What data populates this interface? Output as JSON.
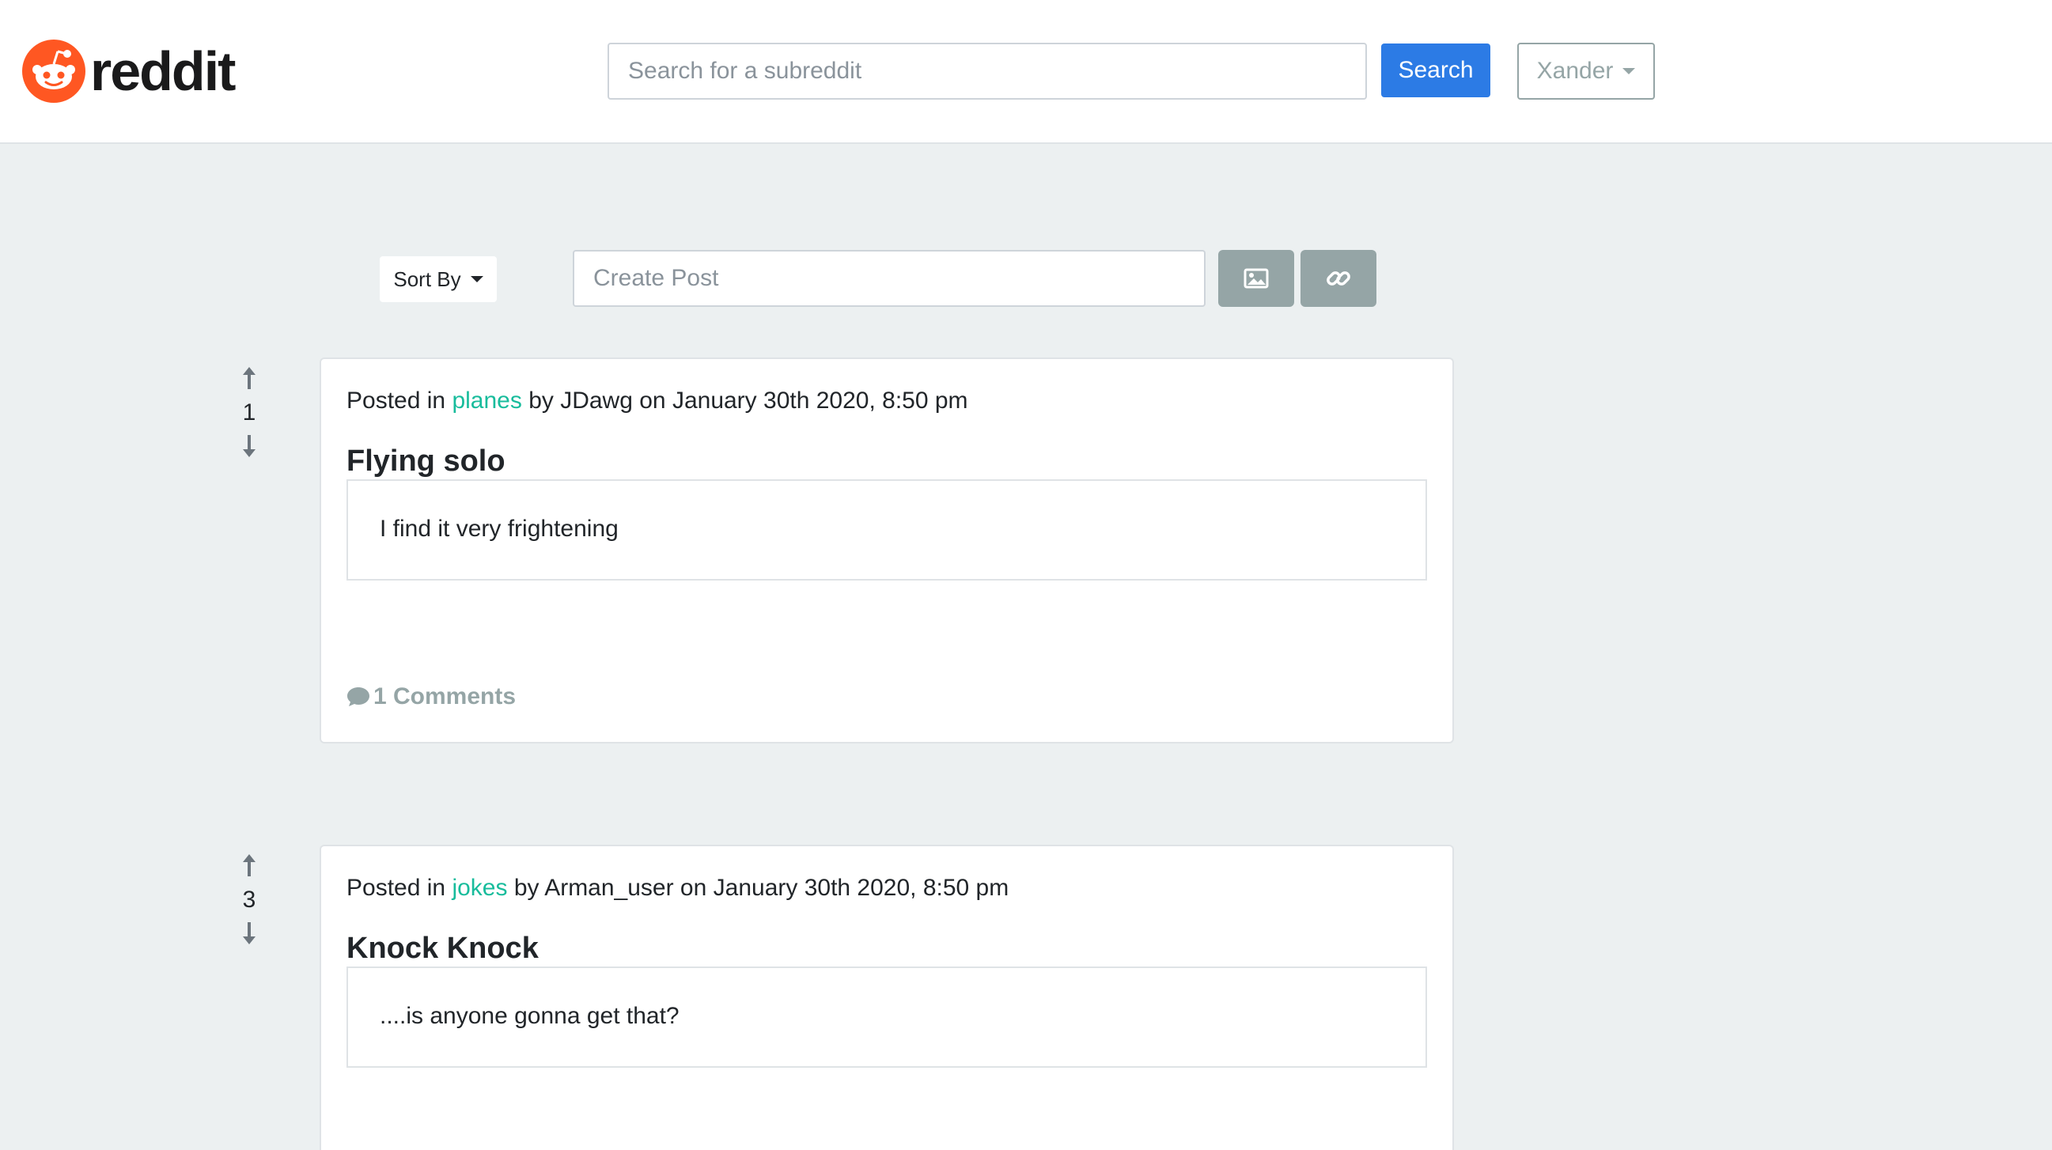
{
  "navbar": {
    "brand": "reddit",
    "search_placeholder": "Search for a subreddit",
    "search_button": "Search",
    "user_menu": "Xander",
    "logo_color": "#ff5722"
  },
  "toolbar": {
    "sort_label": "Sort By",
    "create_post_placeholder": "Create Post",
    "image_button_icon": "image-icon",
    "link_button_icon": "link-icon"
  },
  "posts": [
    {
      "votes": "1",
      "meta_prefix": "Posted in",
      "subreddit": "planes",
      "meta_suffix": "by JDawg on January 30th 2020, 8:50 pm",
      "title": "Flying solo",
      "body": "I find it very frightening",
      "comments": "1 Comments"
    },
    {
      "votes": "3",
      "meta_prefix": "Posted in",
      "subreddit": "jokes",
      "meta_suffix": "by Arman_user on January 30th 2020, 8:50 pm",
      "title": "Knock Knock",
      "body": "....is anyone gonna get that?",
      "comments": ""
    }
  ],
  "colors": {
    "primary": "#2c7be5",
    "secondary": "#95a5a6",
    "link": "#18bc9c",
    "background": "#ecf0f1"
  }
}
